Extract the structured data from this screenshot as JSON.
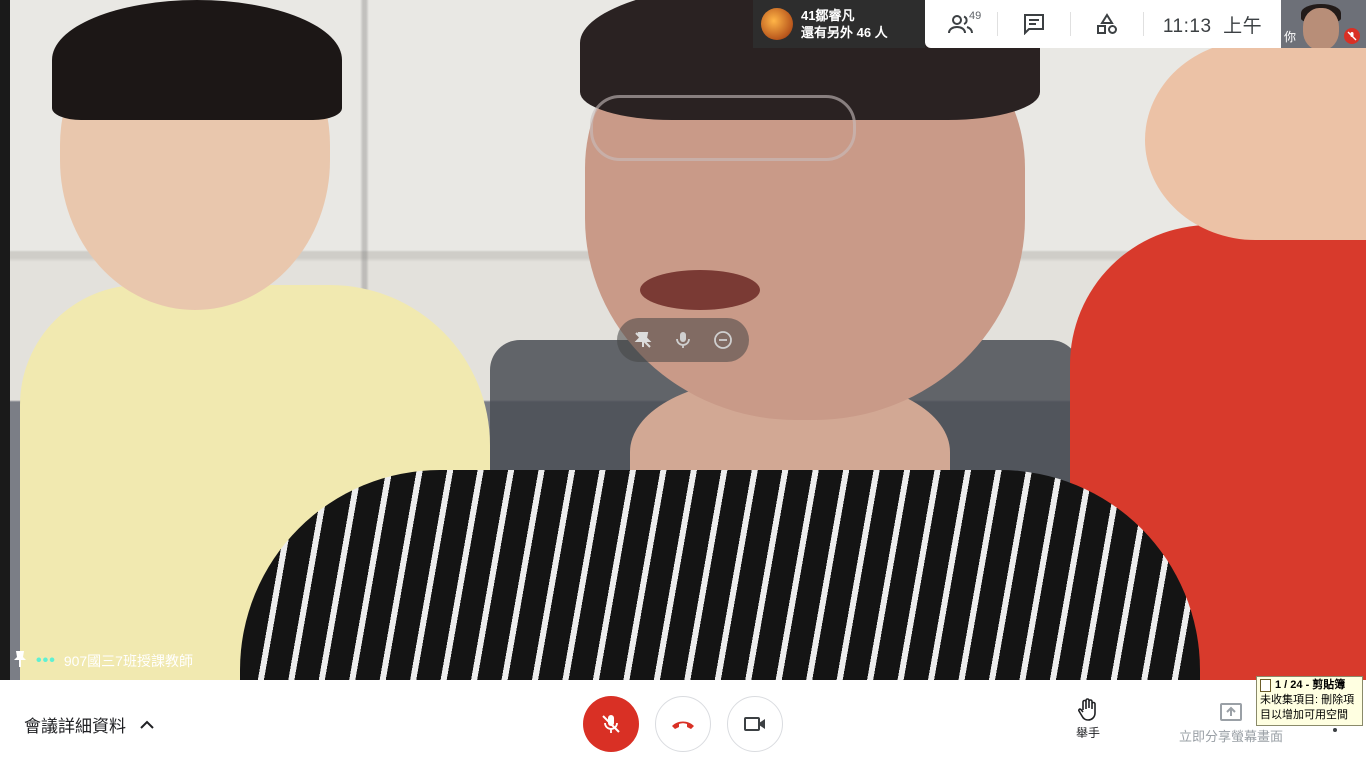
{
  "presenter": {
    "name": "41鄒睿凡",
    "others": "還有另外 46 人"
  },
  "top_bar": {
    "people_count": "49",
    "time": "11:13",
    "ampm": "上午",
    "self_label": "你"
  },
  "participant": {
    "name": "907國三7班授課教師"
  },
  "bottom_bar": {
    "meeting_details": "會議詳細資料",
    "raise_hand": "舉手",
    "present_now": "立即分享螢幕畫面"
  },
  "clipboard_popup": {
    "title": "1 / 24 - 剪貼簿",
    "line1": "未收集項目: 刪除項",
    "line2": "目以增加可用空間"
  },
  "colors": {
    "mute_red": "#d93025",
    "active_dots": "#5ff0d3",
    "presenter_chip_bg": "#2d2d2d"
  }
}
